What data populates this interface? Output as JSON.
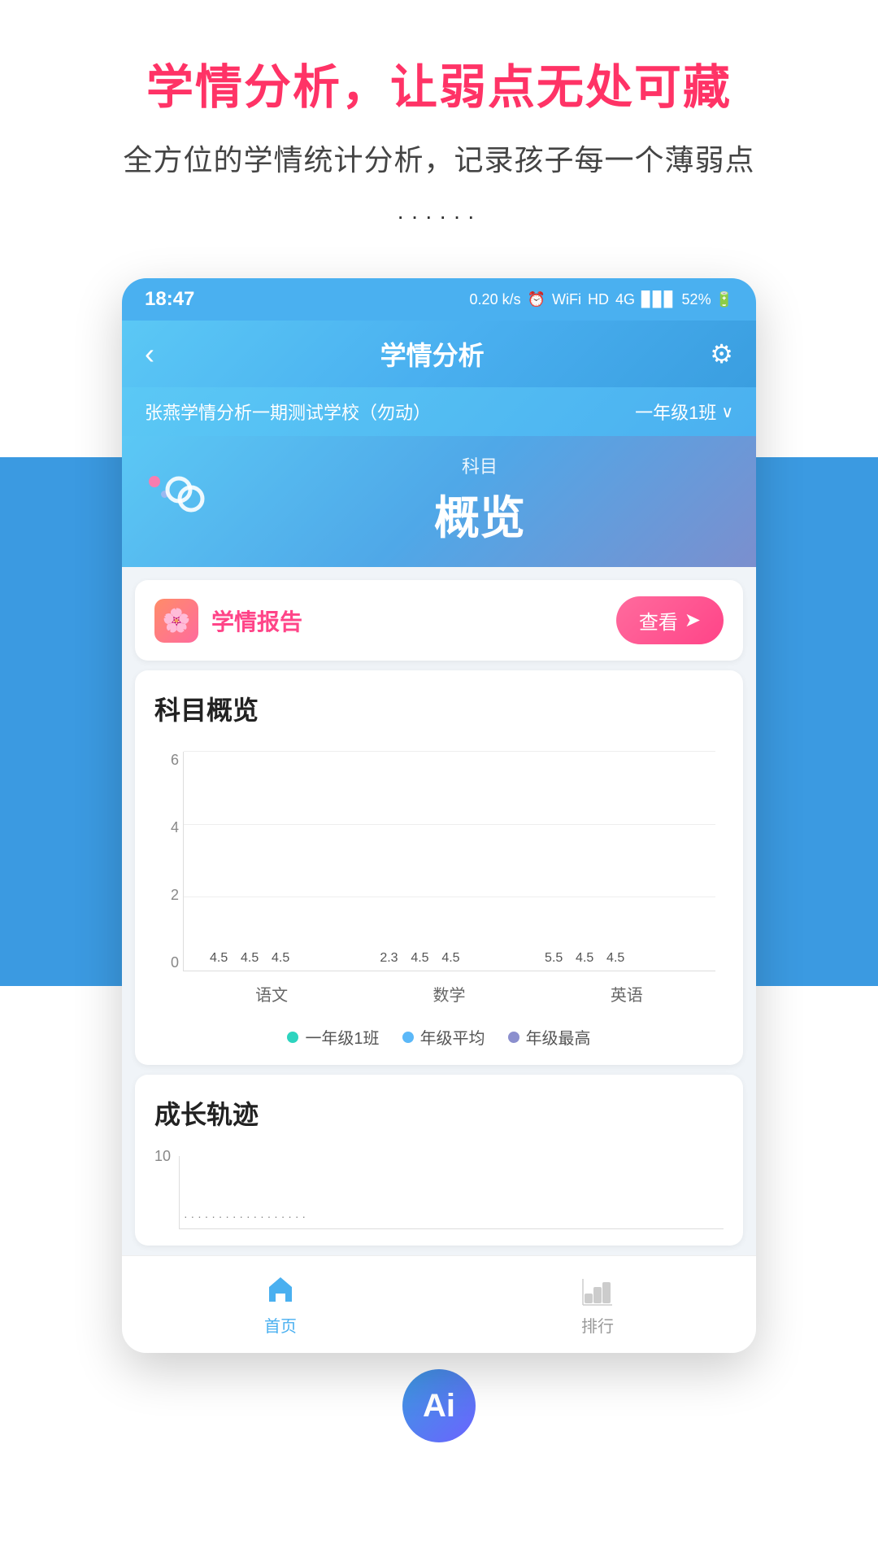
{
  "page": {
    "title": "学情分析，让弱点无处可藏",
    "subtitle": "全方位的学情统计分析，记录孩子每一个薄弱点",
    "dots": "······"
  },
  "statusBar": {
    "time": "18:47",
    "icons": "0.20 k/s ⏰ WiFi HD 4G HD 4G 52%"
  },
  "header": {
    "back": "‹",
    "title": "学情分析",
    "settings": "⚙"
  },
  "schoolBar": {
    "schoolName": "张燕学情分析一期测试学校（勿动）",
    "className": "一年级1班",
    "dropdown": "∨"
  },
  "subjectCard": {
    "subjectLabel": "科目",
    "overviewText": "概览"
  },
  "reportCard": {
    "title": "学情报告",
    "viewBtn": "查看",
    "viewBtnIcon": "⊙"
  },
  "subjectOverview": {
    "sectionTitle": "科目概览",
    "yLabels": [
      "0",
      "2",
      "4",
      "6"
    ],
    "xLabels": [
      "语文",
      "数学",
      "英语"
    ],
    "bars": [
      {
        "subject": "语文",
        "values": [
          4.5,
          4.5,
          4.5
        ],
        "labels": [
          "4.5",
          "4.5",
          "4.5"
        ]
      },
      {
        "subject": "数学",
        "values": [
          2.3,
          4.5,
          4.5
        ],
        "labels": [
          "2.3",
          "4.5",
          "4.5"
        ]
      },
      {
        "subject": "英语",
        "values": [
          5.5,
          4.5,
          4.5
        ],
        "labels": [
          "5.5",
          "4.5",
          "4.5"
        ]
      }
    ],
    "legend": [
      {
        "label": "一年级1班",
        "color": "#2dd4bf"
      },
      {
        "label": "年级平均",
        "color": "#5bb8f8"
      },
      {
        "label": "年级最高",
        "color": "#8b8fce"
      }
    ]
  },
  "growthSection": {
    "sectionTitle": "成长轨迹",
    "yMax": "10"
  },
  "bottomNav": [
    {
      "label": "首页",
      "active": true
    },
    {
      "label": "排行",
      "active": false
    }
  ],
  "ai": {
    "label": "Ai"
  }
}
